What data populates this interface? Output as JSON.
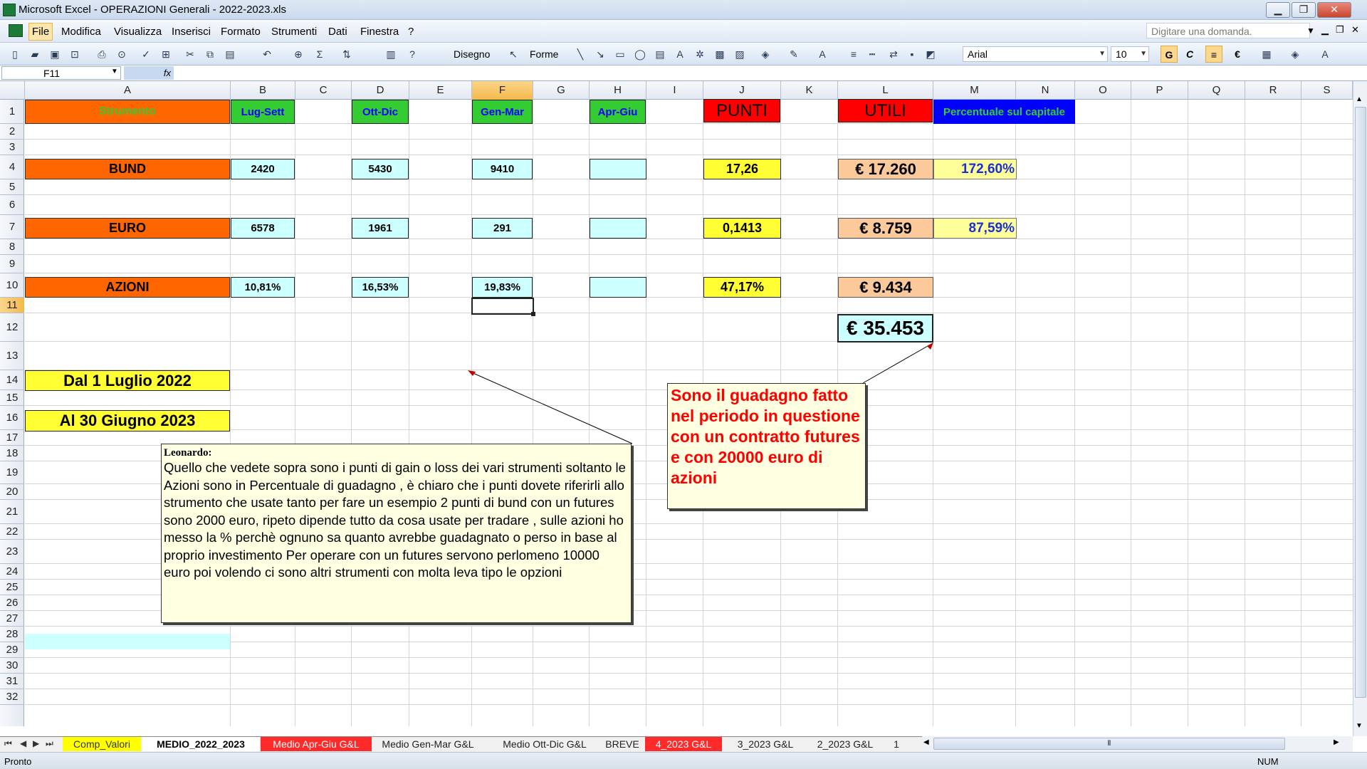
{
  "window": {
    "title": "Microsoft Excel - OPERAZIONI Generali - 2022-2023.xls",
    "min": "▁",
    "max": "❐",
    "close": "✕"
  },
  "menu": {
    "items": [
      "File",
      "Modifica",
      "Visualizza",
      "Inserisci",
      "Formato",
      "Strumenti",
      "Dati",
      "Finestra",
      "?"
    ],
    "ask_placeholder": "Digitare una domanda.",
    "doc_min": "▁",
    "doc_restore": "❐",
    "doc_close": "✕"
  },
  "toolbar": {
    "disegno": "Disegno",
    "forme": "Forme",
    "font": "Arial",
    "size": "10",
    "bold": "G",
    "italic": "C",
    "euro": "€",
    "sigma": "Σ"
  },
  "formula": {
    "cell": "F11",
    "fx": "fx"
  },
  "columns": [
    "A",
    "B",
    "C",
    "D",
    "E",
    "F",
    "G",
    "H",
    "I",
    "J",
    "K",
    "L",
    "M",
    "N",
    "O",
    "P",
    "Q",
    "R",
    "S"
  ],
  "rows": [
    "1",
    "2",
    "3",
    "4",
    "5",
    "6",
    "7",
    "8",
    "9",
    "10",
    "11",
    "12",
    "13",
    "14",
    "15",
    "16",
    "17",
    "18",
    "19",
    "20",
    "21",
    "22",
    "23",
    "24",
    "25",
    "26",
    "27",
    "28",
    "29",
    "30",
    "31",
    "32"
  ],
  "headers": {
    "strumento": "Strumento",
    "lug_sett": "Lug-Sett",
    "ott_dic": "Ott-Dic",
    "gen_mar": "Gen-Mar",
    "apr_giu": "Apr-Giu",
    "punti": "PUNTI",
    "utili": "UTILI",
    "percentuale": "Percentuale sul capitale"
  },
  "table": {
    "bund": {
      "label": "BUND",
      "lug_sett": "2420",
      "ott_dic": "5430",
      "gen_mar": "9410",
      "punti": "17,26",
      "utili": "€ 17.260",
      "pct": "172,60%"
    },
    "euro": {
      "label": "EURO",
      "lug_sett": "6578",
      "ott_dic": "1961",
      "gen_mar": "291",
      "punti": "0,1413",
      "utili": "€ 8.759",
      "pct": "87,59%"
    },
    "azioni": {
      "label": "AZIONI",
      "lug_sett": "10,81%",
      "ott_dic": "16,53%",
      "gen_mar": "19,83%",
      "punti": "47,17%",
      "utili": "€ 9.434"
    },
    "total": "€ 35.453"
  },
  "dates": {
    "from": "Dal 1 Luglio  2022",
    "to": "Al 30 Giugno 2023"
  },
  "comment1": {
    "author": "Leonardo:",
    "text": "Quello che vedete sopra sono i punti di gain o loss dei vari strumenti soltanto le Azioni sono in Percentuale di guadagno , è chiaro che i punti dovete riferirli allo strumento che usate tanto per fare un esempio 2 punti di bund con un futures sono 2000 euro, ripeto dipende tutto da cosa usate per tradare , sulle azioni ho messo la % perchè ognuno sa quanto avrebbe guadagnato o perso in base al proprio investimento Per operare con un futures servono perlomeno 10000 euro poi volendo ci sono altri strumenti con molta leva tipo le opzioni"
  },
  "comment2": {
    "text": "Sono il guadagno fatto nel periodo in questione con un contratto futures e con 20000 euro di azioni"
  },
  "tabs": [
    "Comp_Valori",
    "MEDIO_2022_2023",
    "Medio Apr-Giu G&L",
    "Medio Gen-Mar G&L",
    "Medio Ott-Dic G&L",
    "BREVE",
    "4_2023 G&L",
    "3_2023 G&L",
    "2_2023 G&L",
    "1"
  ],
  "status": {
    "left": "Pronto",
    "num": "NUM"
  },
  "colors": {
    "orange": "#ff6600",
    "green": "#33cc33",
    "red": "#ff0000",
    "blue": "#0000ff",
    "cyan": "#ccffff",
    "yellow": "#ffff33"
  }
}
